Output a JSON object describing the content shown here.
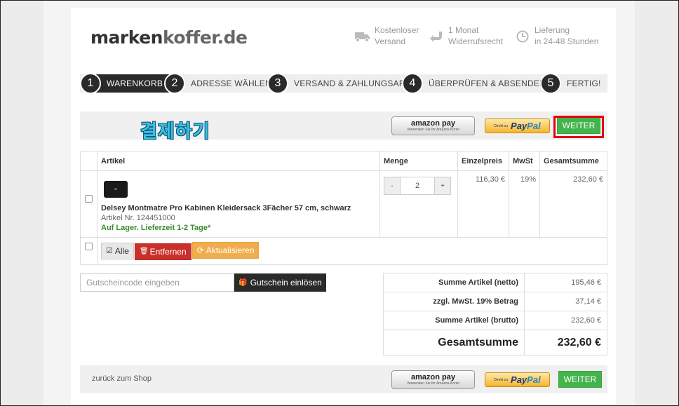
{
  "logo": {
    "part1": "marken",
    "part2": "koffer.de"
  },
  "usps": [
    {
      "icon": "truck-icon",
      "line1": "Kostenloser",
      "line2": "Versand"
    },
    {
      "icon": "return-arrow-icon",
      "line1": "1 Monat",
      "line2": "Widerrufsrecht"
    },
    {
      "icon": "clock-icon",
      "line1": "Lieferung",
      "line2": "in 24-48 Stunden"
    }
  ],
  "steps": [
    {
      "num": "1",
      "label": "WARENKORB"
    },
    {
      "num": "2",
      "label": "ADRESSE WÄHLEN"
    },
    {
      "num": "3",
      "label": "VERSAND & ZAHLUNGSART"
    },
    {
      "num": "4",
      "label": "ÜBERPRÜFEN & ABSENDEN"
    },
    {
      "num": "5",
      "label": "FERTIG!"
    }
  ],
  "annotation": "결제하기",
  "amazon": {
    "title": "amazon pay",
    "subtitle": "Verwenden Sie Ihr Amazon-Konto"
  },
  "paypal": {
    "direct": "Direkt zu",
    "brand1": "Pay",
    "brand2": "Pal"
  },
  "weiter_label": "WEITER",
  "table": {
    "headers": [
      "Artikel",
      "Menge",
      "Einzelpreis",
      "MwSt",
      "Gesamtsumme"
    ],
    "item": {
      "name": "Delsey Montmatre Pro Kabinen Kleidersack 3Fächer 57 cm, schwarz",
      "article_nr": "Artikel Nr. 124451000",
      "stock": "Auf Lager. Lieferzeit 1-2 Tage*",
      "qty": "2",
      "minus": "-",
      "plus": "+",
      "unit_price": "116,30 €",
      "vat": "19%",
      "total": "232,60 €"
    },
    "actions": {
      "all": "Alle",
      "remove": "Entfernen",
      "update": "Aktualisieren"
    }
  },
  "coupon": {
    "placeholder": "Gutscheincode eingeben",
    "button": "Gutschein einlösen"
  },
  "summary": [
    {
      "label": "Summe Artikel (netto)",
      "value": "195,46 €"
    },
    {
      "label": "zzgl. MwSt. 19% Betrag",
      "value": "37,14 €"
    },
    {
      "label": "Summe Artikel (brutto)",
      "value": "232,60 €"
    }
  ],
  "total": {
    "label": "Gesamtsumme",
    "value": "232,60 €"
  },
  "back_link": "zurück zum Shop",
  "colors": {
    "accent_green": "#43b44b",
    "highlight_red": "#e3000f",
    "dark": "#2a2a2a"
  }
}
